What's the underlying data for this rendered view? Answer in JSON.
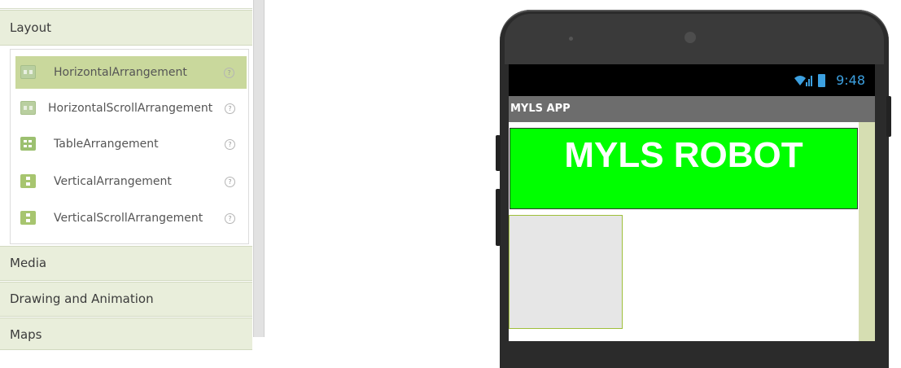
{
  "palette": {
    "categories": {
      "layout": "Layout",
      "media": "Media",
      "drawing": "Drawing and Animation",
      "maps": "Maps"
    },
    "layout_items": [
      {
        "label": "HorizontalArrangement",
        "icon": "horizontal-arrangement-icon",
        "selected": true
      },
      {
        "label": "HorizontalScrollArrangement",
        "icon": "horizontal-scroll-arrangement-icon"
      },
      {
        "label": "TableArrangement",
        "icon": "table-arrangement-icon"
      },
      {
        "label": "VerticalArrangement",
        "icon": "vertical-arrangement-icon"
      },
      {
        "label": "VerticalScrollArrangement",
        "icon": "vertical-scroll-arrangement-icon"
      }
    ],
    "help_glyph": "?"
  },
  "phone": {
    "status_time": "9:48",
    "app_title": "MYLS APP",
    "banner_text": "MYLS ROBOT",
    "banner_color": "#00ff00",
    "status_color": "#3ca0e0"
  }
}
